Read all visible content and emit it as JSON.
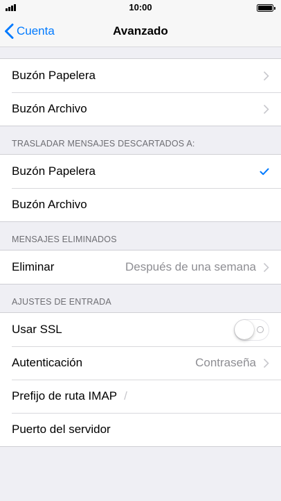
{
  "status_bar": {
    "time": "10:00"
  },
  "nav": {
    "back_label": "Cuenta",
    "title": "Avanzado"
  },
  "mailbox_group": {
    "items": [
      {
        "label": "Buzón Papelera"
      },
      {
        "label": "Buzón Archivo"
      }
    ]
  },
  "move_discarded": {
    "header": "TRASLADAR MENSAJES DESCARTADOS A:",
    "items": [
      {
        "label": "Buzón Papelera",
        "selected": true
      },
      {
        "label": "Buzón Archivo",
        "selected": false
      }
    ]
  },
  "deleted_messages": {
    "header": "MENSAJES ELIMINADOS",
    "delete_label": "Eliminar",
    "delete_value": "Después de una semana"
  },
  "incoming_settings": {
    "header": "AJUSTES DE ENTRADA",
    "ssl_label": "Usar SSL",
    "ssl_enabled": false,
    "auth_label": "Autenticación",
    "auth_value": "Contraseña",
    "imap_prefix_label": "Prefijo de ruta IMAP",
    "imap_prefix_value": "/",
    "server_port_label": "Puerto del servidor"
  },
  "colors": {
    "accent": "#007aff",
    "background": "#efeff4",
    "secondary_text": "#8e8e93",
    "header_text": "#6d6d72"
  }
}
